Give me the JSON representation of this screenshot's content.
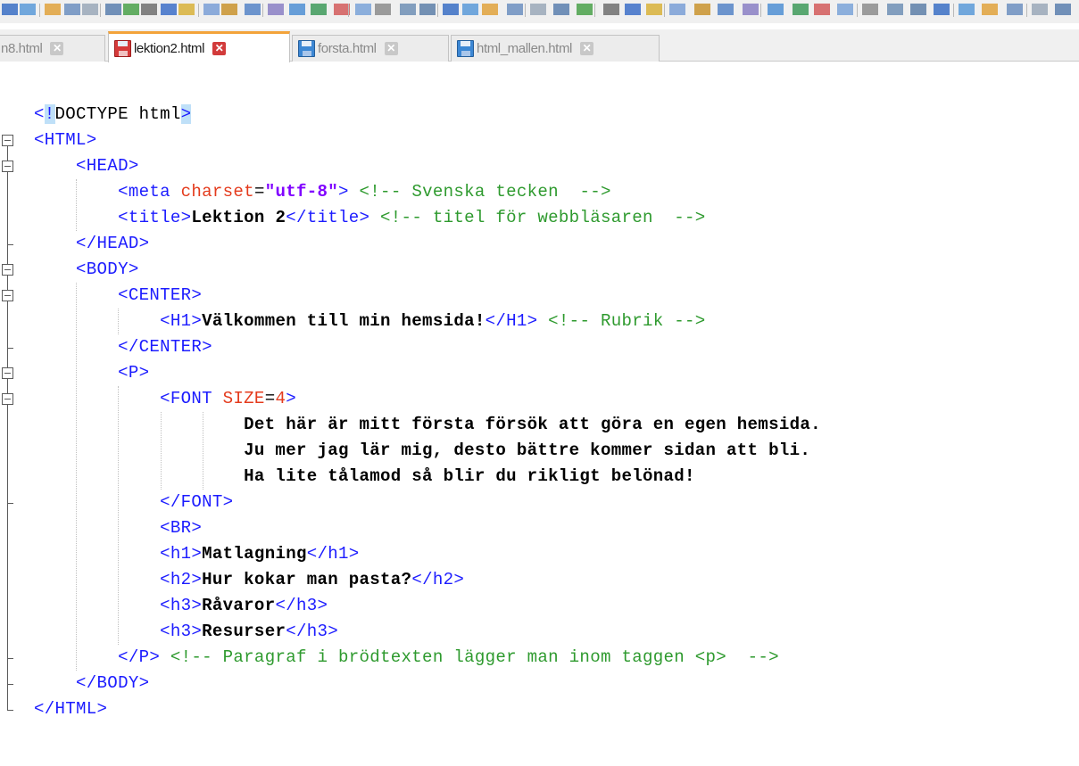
{
  "tabs": [
    {
      "label": "n8.html",
      "active": false
    },
    {
      "label": "lektion2.html",
      "active": true
    },
    {
      "label": "forsta.html",
      "active": false
    },
    {
      "label": "html_mallen.html",
      "active": false
    }
  ],
  "editor": {
    "lines": [
      {
        "segments": [
          {
            "t": "<",
            "c": "tag"
          },
          {
            "t": "!",
            "c": "tag dt-bracket"
          },
          {
            "t": "DOCTYPE html",
            "c": "plain"
          },
          {
            "t": ">",
            "c": "tag dt-bracket"
          }
        ]
      },
      {
        "segments": [
          {
            "t": "<HTML>",
            "c": "tag"
          }
        ]
      },
      {
        "segments": [
          {
            "t": "    <HEAD>",
            "c": "tag"
          }
        ]
      },
      {
        "segments": [
          {
            "t": "        <meta ",
            "c": "tag"
          },
          {
            "t": "charset",
            "c": "attr"
          },
          {
            "t": "=",
            "c": "plain"
          },
          {
            "t": "\"utf-8\"",
            "c": "val"
          },
          {
            "t": ">",
            "c": "tag"
          },
          {
            "t": " <!-- Svenska tecken  -->",
            "c": "cmt"
          }
        ]
      },
      {
        "segments": [
          {
            "t": "        <title>",
            "c": "tag"
          },
          {
            "t": "Lektion 2",
            "c": "txt"
          },
          {
            "t": "</title>",
            "c": "tag"
          },
          {
            "t": " <!-- titel för webbläsaren  -->",
            "c": "cmt"
          }
        ]
      },
      {
        "segments": [
          {
            "t": "    </HEAD>",
            "c": "tag"
          }
        ]
      },
      {
        "segments": [
          {
            "t": "    <BODY>",
            "c": "tag"
          }
        ]
      },
      {
        "segments": [
          {
            "t": "        <CENTER>",
            "c": "tag"
          }
        ]
      },
      {
        "segments": [
          {
            "t": "            <H1>",
            "c": "tag"
          },
          {
            "t": "Välkommen till min hemsida!",
            "c": "txt"
          },
          {
            "t": "</H1>",
            "c": "tag"
          },
          {
            "t": " <!-- Rubrik -->",
            "c": "cmt"
          }
        ]
      },
      {
        "segments": [
          {
            "t": "        </CENTER>",
            "c": "tag"
          }
        ]
      },
      {
        "segments": [
          {
            "t": "        <P>",
            "c": "tag"
          }
        ]
      },
      {
        "segments": [
          {
            "t": "            <FONT ",
            "c": "tag"
          },
          {
            "t": "SIZE",
            "c": "attr"
          },
          {
            "t": "=",
            "c": "plain"
          },
          {
            "t": "4",
            "c": "attr"
          },
          {
            "t": ">",
            "c": "tag"
          }
        ]
      },
      {
        "segments": [
          {
            "t": "                    Det här är mitt första försök att göra en egen hemsida.",
            "c": "txt"
          }
        ]
      },
      {
        "segments": [
          {
            "t": "                    Ju mer jag lär mig, desto bättre kommer sidan att bli.",
            "c": "txt"
          }
        ]
      },
      {
        "segments": [
          {
            "t": "                    Ha lite tålamod så blir du rikligt belönad!",
            "c": "txt"
          }
        ]
      },
      {
        "segments": [
          {
            "t": "            </FONT>",
            "c": "tag"
          }
        ]
      },
      {
        "segments": [
          {
            "t": "            <BR>",
            "c": "tag"
          }
        ]
      },
      {
        "segments": [
          {
            "t": "            <h1>",
            "c": "tag"
          },
          {
            "t": "Matlagning",
            "c": "txt"
          },
          {
            "t": "</h1>",
            "c": "tag"
          }
        ]
      },
      {
        "segments": [
          {
            "t": "            <h2>",
            "c": "tag"
          },
          {
            "t": "Hur kokar man pasta?",
            "c": "txt"
          },
          {
            "t": "</h2>",
            "c": "tag"
          }
        ]
      },
      {
        "segments": [
          {
            "t": "            <h3>",
            "c": "tag"
          },
          {
            "t": "Råvaror",
            "c": "txt"
          },
          {
            "t": "</h3>",
            "c": "tag"
          }
        ]
      },
      {
        "segments": [
          {
            "t": "            <h3>",
            "c": "tag"
          },
          {
            "t": "Resurser",
            "c": "txt"
          },
          {
            "t": "</h3>",
            "c": "tag"
          }
        ]
      },
      {
        "segments": [
          {
            "t": "        </P>",
            "c": "tag"
          },
          {
            "t": " <!-- Paragraf i brödtexten lägger man inom taggen <p>  -->",
            "c": "cmt"
          }
        ]
      },
      {
        "segments": [
          {
            "t": "    </BODY>",
            "c": "tag"
          }
        ]
      },
      {
        "segments": [
          {
            "t": "</HTML>",
            "c": "tag"
          }
        ]
      }
    ]
  },
  "colors": {
    "tag": "#1c1cff",
    "attribute": "#e43b1d",
    "attribute_value": "#8000ff",
    "comment": "#2e9a2e",
    "text": "#000000",
    "active_tab_accent": "#f3a33a"
  },
  "icons": [
    "close-tab-icon",
    "save-disk-icon"
  ]
}
